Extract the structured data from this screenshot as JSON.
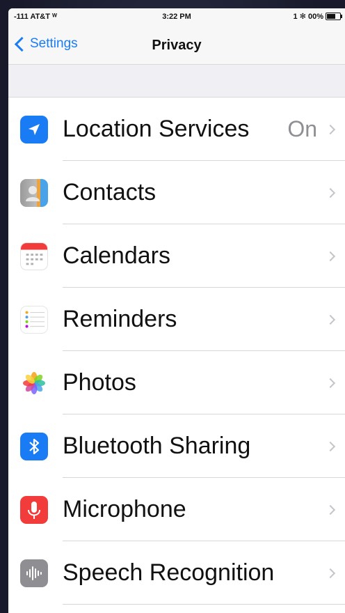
{
  "status_bar": {
    "carrier": "-111 AT&T ᵂ",
    "time": "3:22 PM",
    "battery_text": "1 ✻ 00%"
  },
  "nav": {
    "back_label": "Settings",
    "title": "Privacy"
  },
  "rows": [
    {
      "label": "Location Services",
      "value": "On",
      "icon": "location-arrow-icon"
    },
    {
      "label": "Contacts",
      "value": "",
      "icon": "contacts-icon"
    },
    {
      "label": "Calendars",
      "value": "",
      "icon": "calendar-icon"
    },
    {
      "label": "Reminders",
      "value": "",
      "icon": "reminders-icon"
    },
    {
      "label": "Photos",
      "value": "",
      "icon": "photos-icon"
    },
    {
      "label": "Bluetooth Sharing",
      "value": "",
      "icon": "bluetooth-icon"
    },
    {
      "label": "Microphone",
      "value": "",
      "icon": "microphone-icon"
    },
    {
      "label": "Speech Recognition",
      "value": "",
      "icon": "speech-waveform-icon"
    }
  ],
  "colors": {
    "accent": "#1a7cf5",
    "microphone": "#f23c3c",
    "speech": "#8e8e93",
    "group_background": "#efeff4"
  }
}
